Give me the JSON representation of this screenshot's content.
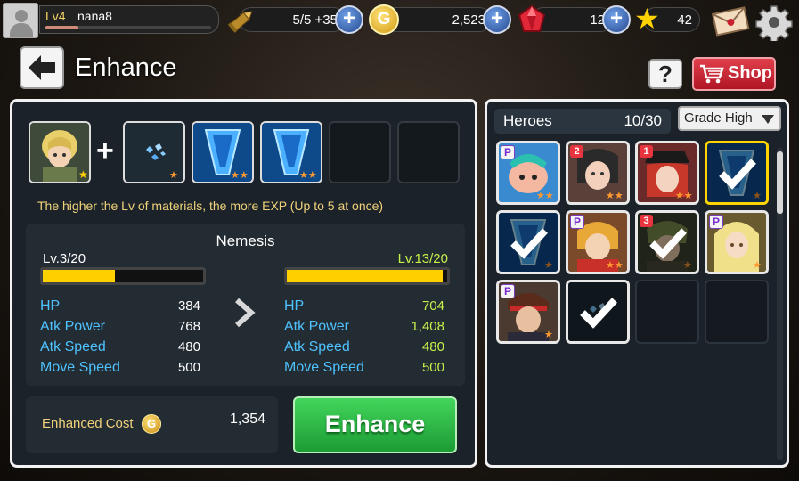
{
  "player": {
    "level": "Lv4",
    "name": "nana8",
    "exp_fraction": 0.2
  },
  "resources": {
    "stamina": "5/5 +35",
    "gold": "2,523",
    "gems": "12",
    "stars": "42",
    "plus_label": "+"
  },
  "colors": {
    "accent_gold": "#f2d264",
    "stat_blue": "#4ec3ff",
    "stat_green": "#c5f04a",
    "enhance_green": "#2ebf46",
    "shop_red": "#c8202e"
  },
  "header": {
    "title": "Enhance",
    "help_label": "?",
    "shop_label": "Shop",
    "gold_symbol": "G"
  },
  "enhance": {
    "plus_sign": "+",
    "hint": "The higher the Lv of materials, the more EXP (Up to 5 at once)",
    "hero_name": "Nemesis",
    "current": {
      "level": "Lv.3/20",
      "exp_fraction": 0.45
    },
    "next": {
      "level": "Lv.13/20",
      "exp_fraction": 0.97
    },
    "stats": [
      {
        "label": "HP",
        "before": "384",
        "after": "704"
      },
      {
        "label": "Atk Power",
        "before": "768",
        "after": "1,408"
      },
      {
        "label": "Atk Speed",
        "before": "480",
        "after": "480"
      },
      {
        "label": "Move Speed",
        "before": "500",
        "after": "500"
      }
    ],
    "cost_label": "Enhanced Cost",
    "cost_value": "1,354",
    "button_label": "Enhance",
    "materials": [
      "hero-portrait",
      "crystal-shards",
      "blue-crystal",
      "blue-crystal",
      "empty",
      "empty"
    ]
  },
  "heroes": {
    "title": "Heroes",
    "count": "10/30",
    "sort_label": "Grade High",
    "grid": [
      {
        "badge": "P",
        "badge_type": "p",
        "portrait": "blue-mascot",
        "checked": false,
        "stars": 2
      },
      {
        "badge": "2",
        "badge_type": "n",
        "portrait": "dark-hair-girl",
        "checked": false,
        "stars": 2
      },
      {
        "badge": "1",
        "badge_type": "n",
        "portrait": "pirate-girl",
        "checked": false,
        "stars": 2
      },
      {
        "badge": "",
        "badge_type": "none",
        "portrait": "blue-crystal",
        "checked": true,
        "selected": true,
        "stars": 1
      },
      {
        "badge": "",
        "badge_type": "none",
        "portrait": "blue-crystal",
        "checked": true,
        "stars": 1
      },
      {
        "badge": "P",
        "badge_type": "p",
        "portrait": "blonde-fighter",
        "checked": false,
        "stars": 2
      },
      {
        "badge": "3",
        "badge_type": "n",
        "portrait": "green-hair-hero",
        "checked": true,
        "stars": 1
      },
      {
        "badge": "P",
        "badge_type": "p",
        "portrait": "blonde-girl",
        "checked": false,
        "stars": 1
      },
      {
        "badge": "P",
        "badge_type": "p",
        "portrait": "headband-boy",
        "checked": false,
        "stars": 1
      },
      {
        "badge": "",
        "badge_type": "none",
        "portrait": "crystal-shards",
        "checked": true,
        "stars": 0
      },
      {
        "badge": "",
        "badge_type": "empty",
        "portrait": "",
        "checked": false,
        "stars": 0
      },
      {
        "badge": "",
        "badge_type": "empty",
        "portrait": "",
        "checked": false,
        "stars": 0
      }
    ]
  }
}
